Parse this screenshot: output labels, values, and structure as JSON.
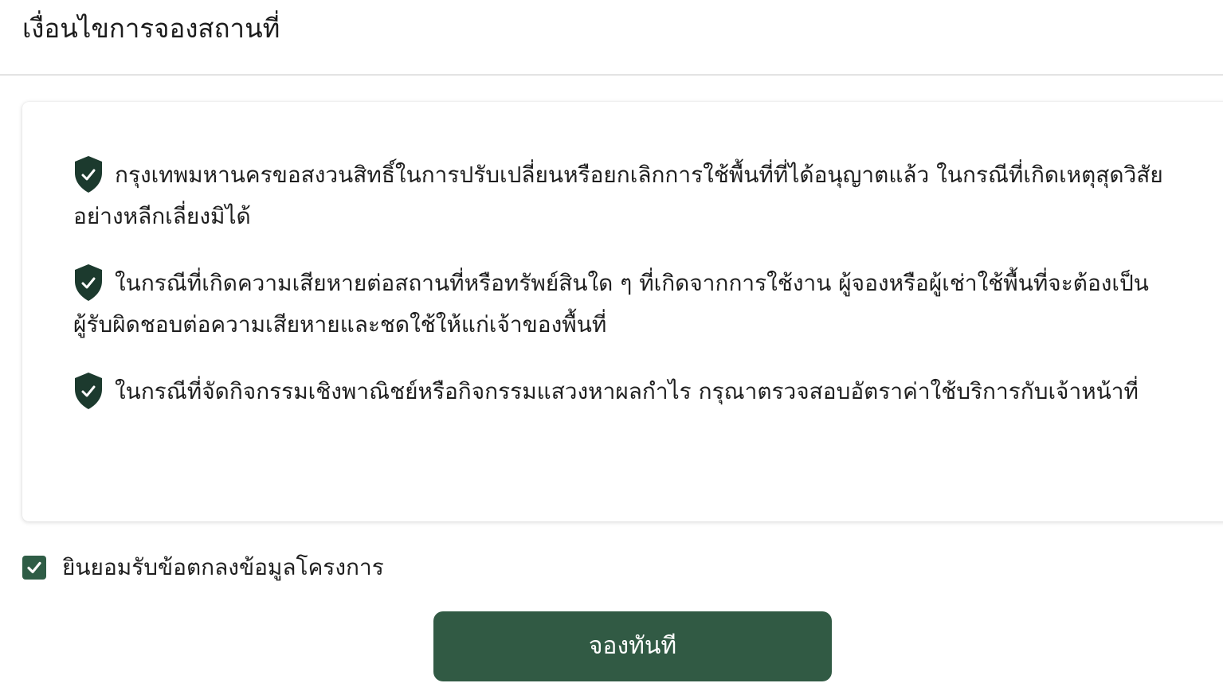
{
  "header": {
    "title": "เงื่อนไขการจองสถานที่"
  },
  "terms": [
    {
      "icon": "shield-check-icon",
      "text": "กรุงเทพมหานครขอสงวนสิทธิ์ในการปรับเปลี่ยนหรือยกเลิกการใช้พื้นที่ที่ได้อนุญาตแล้ว ในกรณีที่เกิดเหตุสุดวิสัยอย่างหลีกเลี่ยงมิได้"
    },
    {
      "icon": "shield-check-icon",
      "text": "ในกรณีที่เกิดความเสียหายต่อสถานที่หรือทรัพย์สินใด ๆ ที่เกิดจากการใช้งาน ผู้จองหรือผู้เช่าใช้พื้นที่จะต้องเป็นผู้รับผิดชอบต่อความเสียหายและชดใช้ให้แก่เจ้าของพื้นที่"
    },
    {
      "icon": "shield-check-icon",
      "text": "ในกรณีที่จัดกิจกรรมเชิงพาณิชย์หรือกิจกรรมแสวงหาผลกำไร กรุณาตรวจสอบอัตราค่าใช้บริการกับเจ้าหน้าที่"
    }
  ],
  "agreement": {
    "checked": true,
    "label": "ยินยอมรับข้อตกลงข้อมูลโครงการ"
  },
  "actions": {
    "book_label": "จองทันที"
  },
  "colors": {
    "accent": "#315a44",
    "shield": "#1c3a2e"
  }
}
